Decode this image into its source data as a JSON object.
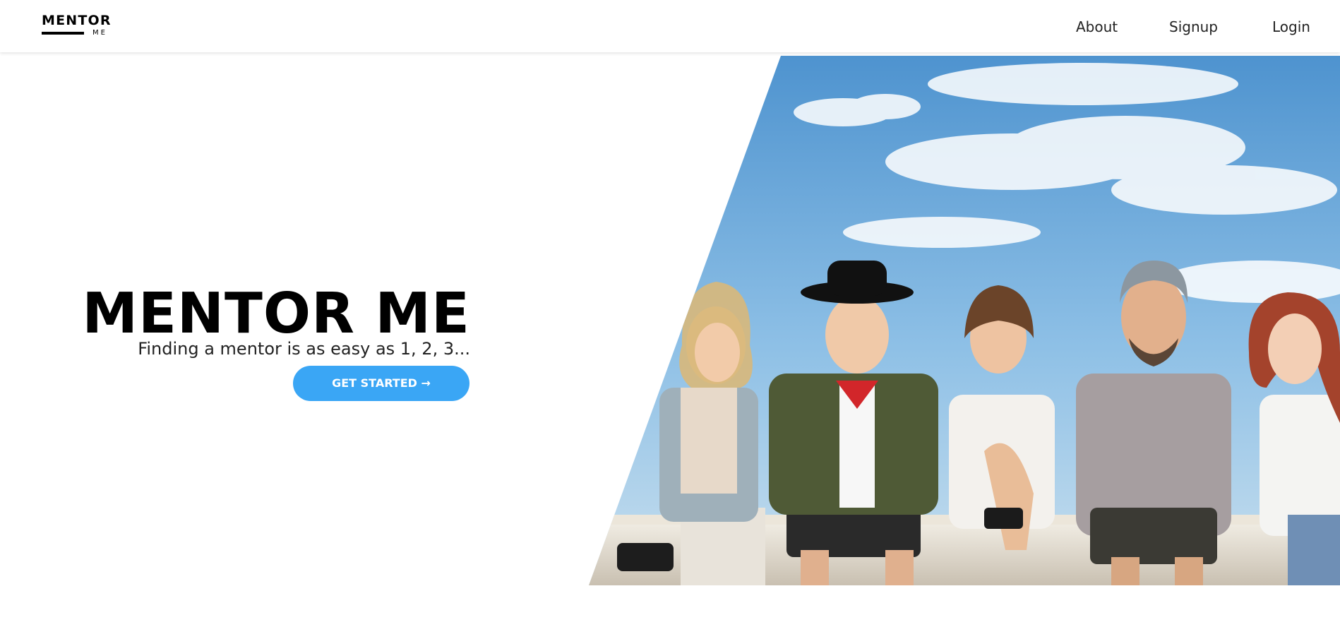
{
  "brand": {
    "logo_top": "MENTOR",
    "logo_bottom": "ME"
  },
  "nav": {
    "items": [
      {
        "label": "About"
      },
      {
        "label": "Signup"
      },
      {
        "label": "Login"
      }
    ]
  },
  "hero": {
    "title": "MENTOR ME",
    "subtitle": "Finding a mentor is as easy as 1, 2, 3...",
    "cta_label": "GET STARTED →",
    "image_subject": "group of five smiling friends sitting on a ledge under a blue sky"
  },
  "colors": {
    "accent": "#3aa6f5",
    "text": "#000000",
    "background": "#ffffff"
  }
}
